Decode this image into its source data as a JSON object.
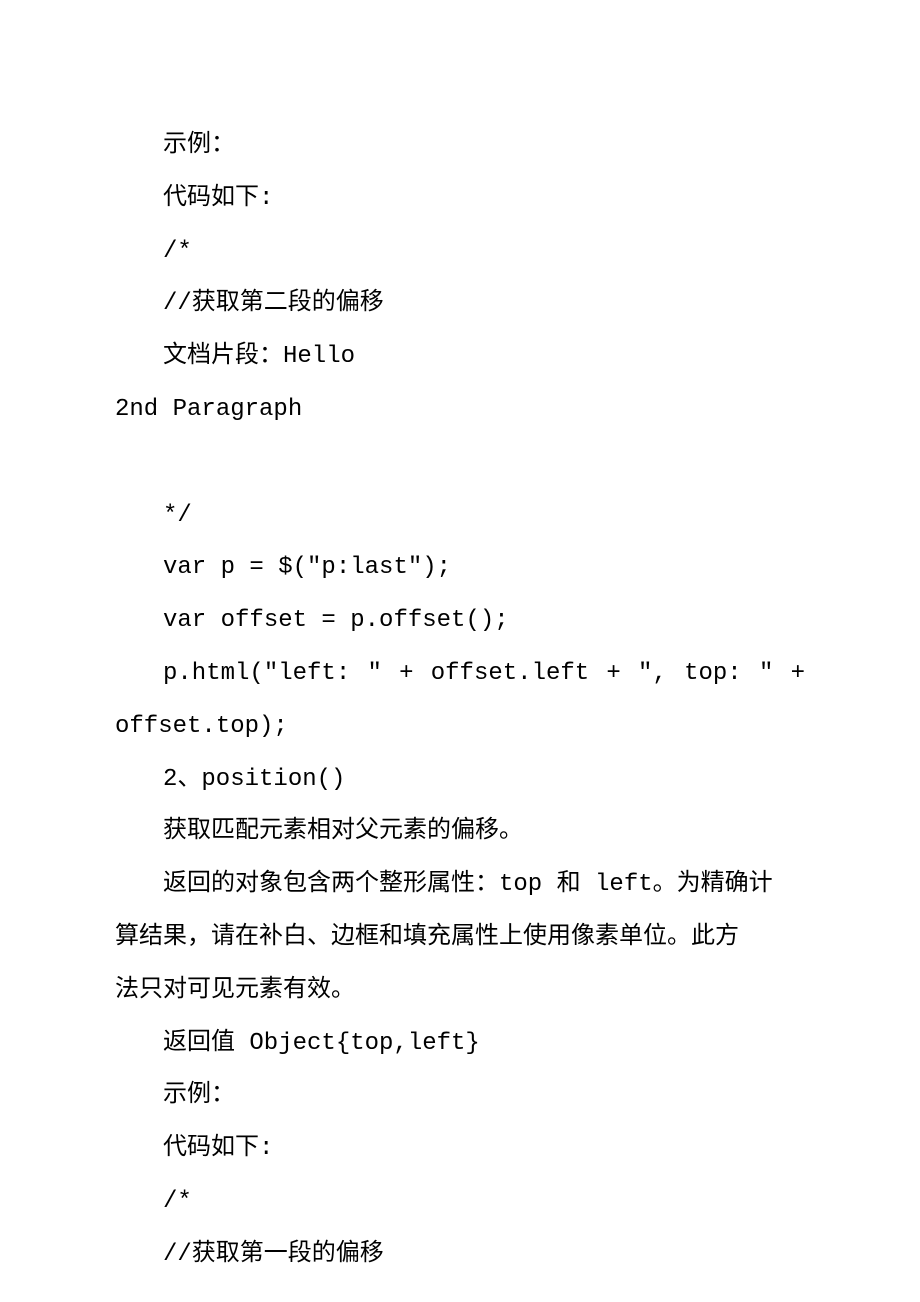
{
  "document": {
    "lines": [
      {
        "text": "示例：",
        "indented": true,
        "justified": false
      },
      {
        "text": "代码如下:",
        "indented": true,
        "justified": false
      },
      {
        "text": "/*",
        "indented": true,
        "justified": false
      },
      {
        "text": "//获取第二段的偏移",
        "indented": true,
        "justified": false
      },
      {
        "text": "文档片段：Hello",
        "indented": true,
        "justified": false
      },
      {
        "text": "2nd Paragraph",
        "indented": false,
        "justified": false
      },
      {
        "text": "",
        "indented": false,
        "justified": false
      },
      {
        "text": "*/",
        "indented": true,
        "justified": false
      },
      {
        "text": "var p = $(\"p:last\");",
        "indented": true,
        "justified": false
      },
      {
        "text": "var offset = p.offset();",
        "indented": true,
        "justified": false
      },
      {
        "text": " p.html(\"left: \" + offset.left + \", top: \" +",
        "indented": true,
        "justified": true
      },
      {
        "text": "offset.top);",
        "indented": false,
        "justified": false
      },
      {
        "text": "2、position()",
        "indented": true,
        "justified": false
      },
      {
        "text": "获取匹配元素相对父元素的偏移。",
        "indented": true,
        "justified": false
      },
      {
        "text": "返回的对象包含两个整形属性：top 和 left。为精确计",
        "indented": true,
        "justified": false
      },
      {
        "text": "算结果，请在补白、边框和填充属性上使用像素单位。此方",
        "indented": false,
        "justified": false
      },
      {
        "text": "法只对可见元素有效。",
        "indented": false,
        "justified": false
      },
      {
        "text": "返回值 Object{top,left}",
        "indented": true,
        "justified": false
      },
      {
        "text": "示例：",
        "indented": true,
        "justified": false
      },
      {
        "text": "代码如下:",
        "indented": true,
        "justified": false
      },
      {
        "text": "/*",
        "indented": true,
        "justified": false
      },
      {
        "text": "//获取第一段的偏移",
        "indented": true,
        "justified": false
      }
    ]
  }
}
